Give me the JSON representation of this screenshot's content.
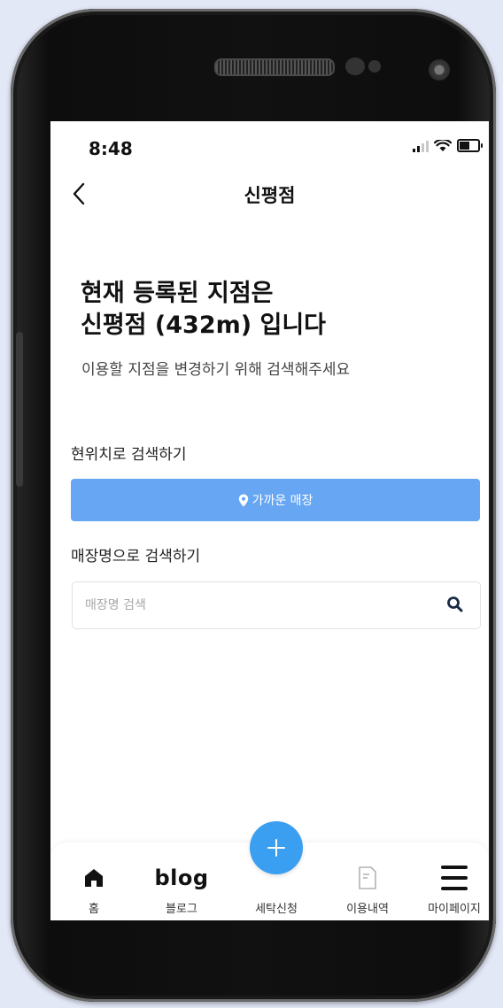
{
  "status_bar": {
    "time": "8:48"
  },
  "header": {
    "title": "신평점"
  },
  "main": {
    "headline_line1": "현재 등록된 지점은",
    "headline_line2": "신평점 (432m) 입니다",
    "subtext": "이용할 지점을 변경하기 위해 검색해주세요",
    "location_section_label": "현위치로 검색하기",
    "nearby_button_label": "가까운 매장",
    "name_section_label": "매장명으로 검색하기",
    "search_placeholder": "매장명 검색"
  },
  "tab_bar": {
    "home_label": "홈",
    "blog_icon_text": "blog",
    "blog_label": "블로그",
    "laundry_label": "세탁신청",
    "history_label": "이용내역",
    "mypage_label": "마이페이지"
  },
  "colors": {
    "accent_button": "#66a6f2",
    "fab": "#3a9ff0",
    "background": "#e3e8f7"
  },
  "icons": [
    "back-chevron-icon",
    "location-pin-icon",
    "search-icon",
    "home-icon",
    "plus-icon",
    "history-document-icon",
    "menu-icon",
    "signal-icon",
    "wifi-icon",
    "battery-icon"
  ]
}
